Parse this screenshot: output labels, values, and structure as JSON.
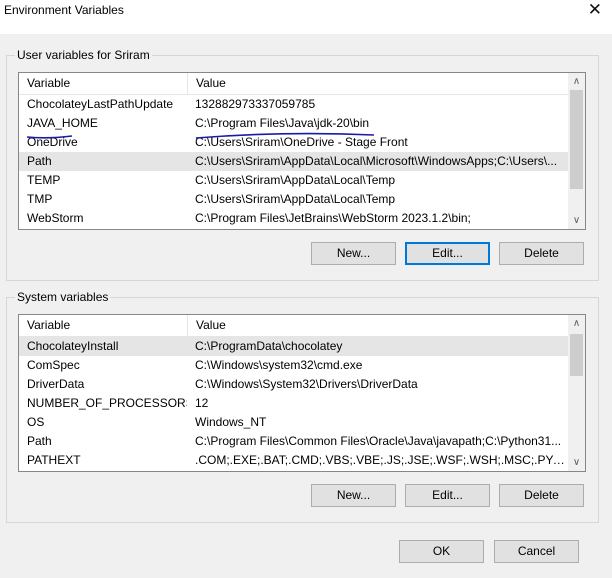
{
  "window": {
    "title": "Environment Variables",
    "close_glyph": "✕"
  },
  "user_vars": {
    "group_label": "User variables for Sriram",
    "headers": [
      "Variable",
      "Value"
    ],
    "rows": [
      {
        "name": "ChocolateyLastPathUpdate",
        "value": "132882973337059785"
      },
      {
        "name": "JAVA_HOME",
        "value": "C:\\Program Files\\Java\\jdk-20\\bin"
      },
      {
        "name": "OneDrive",
        "value": "C:\\Users\\Sriram\\OneDrive - Stage Front"
      },
      {
        "name": "Path",
        "value": "C:\\Users\\Sriram\\AppData\\Local\\Microsoft\\WindowsApps;C:\\Users\\..."
      },
      {
        "name": "TEMP",
        "value": "C:\\Users\\Sriram\\AppData\\Local\\Temp"
      },
      {
        "name": "TMP",
        "value": "C:\\Users\\Sriram\\AppData\\Local\\Temp"
      },
      {
        "name": "WebStorm",
        "value": "C:\\Program Files\\JetBrains\\WebStorm 2023.1.2\\bin;"
      }
    ],
    "selected_row": "Path",
    "buttons": {
      "new": "New...",
      "edit": "Edit...",
      "delete": "Delete"
    }
  },
  "system_vars": {
    "group_label": "System variables",
    "headers": [
      "Variable",
      "Value"
    ],
    "rows": [
      {
        "name": "ChocolateyInstall",
        "value": "C:\\ProgramData\\chocolatey"
      },
      {
        "name": "ComSpec",
        "value": "C:\\Windows\\system32\\cmd.exe"
      },
      {
        "name": "DriverData",
        "value": "C:\\Windows\\System32\\Drivers\\DriverData"
      },
      {
        "name": "NUMBER_OF_PROCESSORS",
        "value": "12"
      },
      {
        "name": "OS",
        "value": "Windows_NT"
      },
      {
        "name": "Path",
        "value": "C:\\Program Files\\Common Files\\Oracle\\Java\\javapath;C:\\Python31..."
      },
      {
        "name": "PATHEXT",
        "value": ".COM;.EXE;.BAT;.CMD;.VBS;.VBE;.JS;.JSE;.WSF;.WSH;.MSC;.PY;.PYW"
      }
    ],
    "selected_row": "ChocolateyInstall",
    "buttons": {
      "new": "New...",
      "edit": "Edit...",
      "delete": "Delete"
    }
  },
  "dialog_buttons": {
    "ok": "OK",
    "cancel": "Cancel"
  },
  "colors": {
    "annotation": "#1a1aa8",
    "focus": "#0078d7",
    "selection": "#e5e5e5"
  },
  "icons": {
    "scroll_up": "chevron-up-icon",
    "scroll_down": "chevron-down-icon",
    "close": "close-icon"
  }
}
